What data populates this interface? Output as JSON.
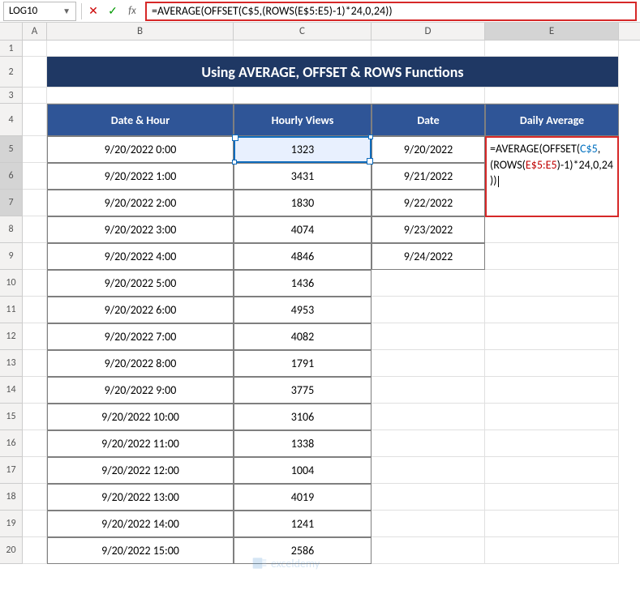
{
  "nameBox": "LOG10",
  "formulaBar": "=AVERAGE(OFFSET(C$5,(ROWS(E$5:E5)-1)*24,0,24))",
  "columns": [
    "A",
    "B",
    "C",
    "D",
    "E"
  ],
  "title": "Using AVERAGE, OFFSET & ROWS Functions",
  "headers": {
    "b": "Date & Hour",
    "c": "Hourly Views",
    "d": "Date",
    "e": "Daily Average"
  },
  "rows": [
    {
      "num": 5,
      "b": "9/20/2022 0:00",
      "c": "1323",
      "d": "9/20/2022"
    },
    {
      "num": 6,
      "b": "9/20/2022 1:00",
      "c": "3431",
      "d": "9/21/2022"
    },
    {
      "num": 7,
      "b": "9/20/2022 2:00",
      "c": "1830",
      "d": "9/22/2022"
    },
    {
      "num": 8,
      "b": "9/20/2022 3:00",
      "c": "4074",
      "d": "9/23/2022"
    },
    {
      "num": 9,
      "b": "9/20/2022 4:00",
      "c": "4846",
      "d": "9/24/2022"
    },
    {
      "num": 10,
      "b": "9/20/2022 5:00",
      "c": "1436",
      "d": ""
    },
    {
      "num": 11,
      "b": "9/20/2022 6:00",
      "c": "4953",
      "d": ""
    },
    {
      "num": 12,
      "b": "9/20/2022 7:00",
      "c": "4082",
      "d": ""
    },
    {
      "num": 13,
      "b": "9/20/2022 8:00",
      "c": "1791",
      "d": ""
    },
    {
      "num": 14,
      "b": "9/20/2022 9:00",
      "c": "3775",
      "d": ""
    },
    {
      "num": 15,
      "b": "9/20/2022 10:00",
      "c": "3106",
      "d": ""
    },
    {
      "num": 16,
      "b": "9/20/2022 11:00",
      "c": "1338",
      "d": ""
    },
    {
      "num": 17,
      "b": "9/20/2022 12:00",
      "c": "1004",
      "d": ""
    },
    {
      "num": 18,
      "b": "9/20/2022 13:00",
      "c": "4019",
      "d": ""
    },
    {
      "num": 19,
      "b": "9/20/2022 14:00",
      "c": "1241",
      "d": ""
    },
    {
      "num": 20,
      "b": "9/20/2022 15:00",
      "c": "2586",
      "d": ""
    }
  ],
  "overlay": {
    "part1": "=AVERAGE(OFFSET(",
    "part2": "C$5",
    "part3": ",(ROWS(",
    "part4": "E$5:E5",
    "part5": ")-1)*24,0,24))"
  },
  "watermark": "exceldemy",
  "chart_data": {
    "type": "table",
    "title": "Using AVERAGE, OFFSET & ROWS Functions",
    "columns": [
      "Date & Hour",
      "Hourly Views",
      "Date",
      "Daily Average"
    ],
    "data": [
      [
        "9/20/2022 0:00",
        1323,
        "9/20/2022",
        null
      ],
      [
        "9/20/2022 1:00",
        3431,
        "9/21/2022",
        null
      ],
      [
        "9/20/2022 2:00",
        1830,
        "9/22/2022",
        null
      ],
      [
        "9/20/2022 3:00",
        4074,
        "9/23/2022",
        null
      ],
      [
        "9/20/2022 4:00",
        4846,
        "9/24/2022",
        null
      ],
      [
        "9/20/2022 5:00",
        1436,
        null,
        null
      ],
      [
        "9/20/2022 6:00",
        4953,
        null,
        null
      ],
      [
        "9/20/2022 7:00",
        4082,
        null,
        null
      ],
      [
        "9/20/2022 8:00",
        1791,
        null,
        null
      ],
      [
        "9/20/2022 9:00",
        3775,
        null,
        null
      ],
      [
        "9/20/2022 10:00",
        3106,
        null,
        null
      ],
      [
        "9/20/2022 11:00",
        1338,
        null,
        null
      ],
      [
        "9/20/2022 12:00",
        1004,
        null,
        null
      ],
      [
        "9/20/2022 13:00",
        4019,
        null,
        null
      ],
      [
        "9/20/2022 14:00",
        1241,
        null,
        null
      ],
      [
        "9/20/2022 15:00",
        2586,
        null,
        null
      ]
    ]
  }
}
